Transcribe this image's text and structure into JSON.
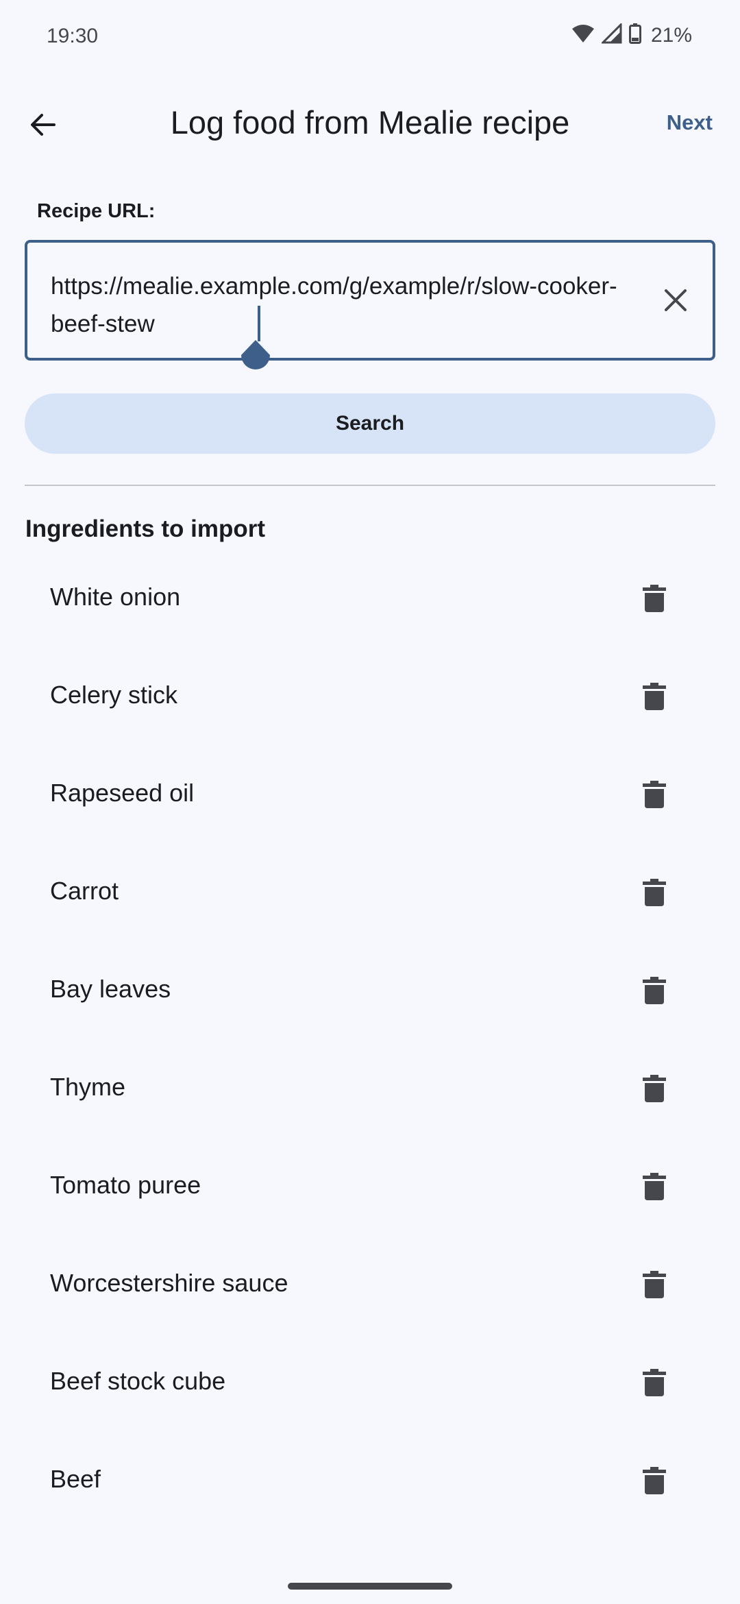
{
  "status_bar": {
    "time": "19:30",
    "battery_percent": "21%",
    "icons": [
      "wifi-icon",
      "signal-icon",
      "battery-icon"
    ]
  },
  "app_bar": {
    "back_icon": "arrow-back-icon",
    "title": "Log food from Mealie recipe",
    "next_label": "Next"
  },
  "url_field": {
    "label": "Recipe URL:",
    "value": "https://mealie.example.com/g/example/r/slow-cooker-beef-stew",
    "clear_icon": "close-icon"
  },
  "search_button": {
    "label": "Search"
  },
  "ingredients": {
    "title": "Ingredients to import",
    "delete_icon": "trash-icon",
    "items": [
      {
        "name": "White onion"
      },
      {
        "name": "Celery stick"
      },
      {
        "name": "Rapeseed oil"
      },
      {
        "name": "Carrot"
      },
      {
        "name": "Bay leaves"
      },
      {
        "name": "Thyme"
      },
      {
        "name": "Tomato puree"
      },
      {
        "name": "Worcestershire sauce"
      },
      {
        "name": "Beef stock cube"
      },
      {
        "name": "Beef"
      }
    ]
  },
  "colors": {
    "accent": "#3e5f8a",
    "background": "#f6f8fd",
    "button_container": "#d7e3f6",
    "icon": "#45474d"
  }
}
